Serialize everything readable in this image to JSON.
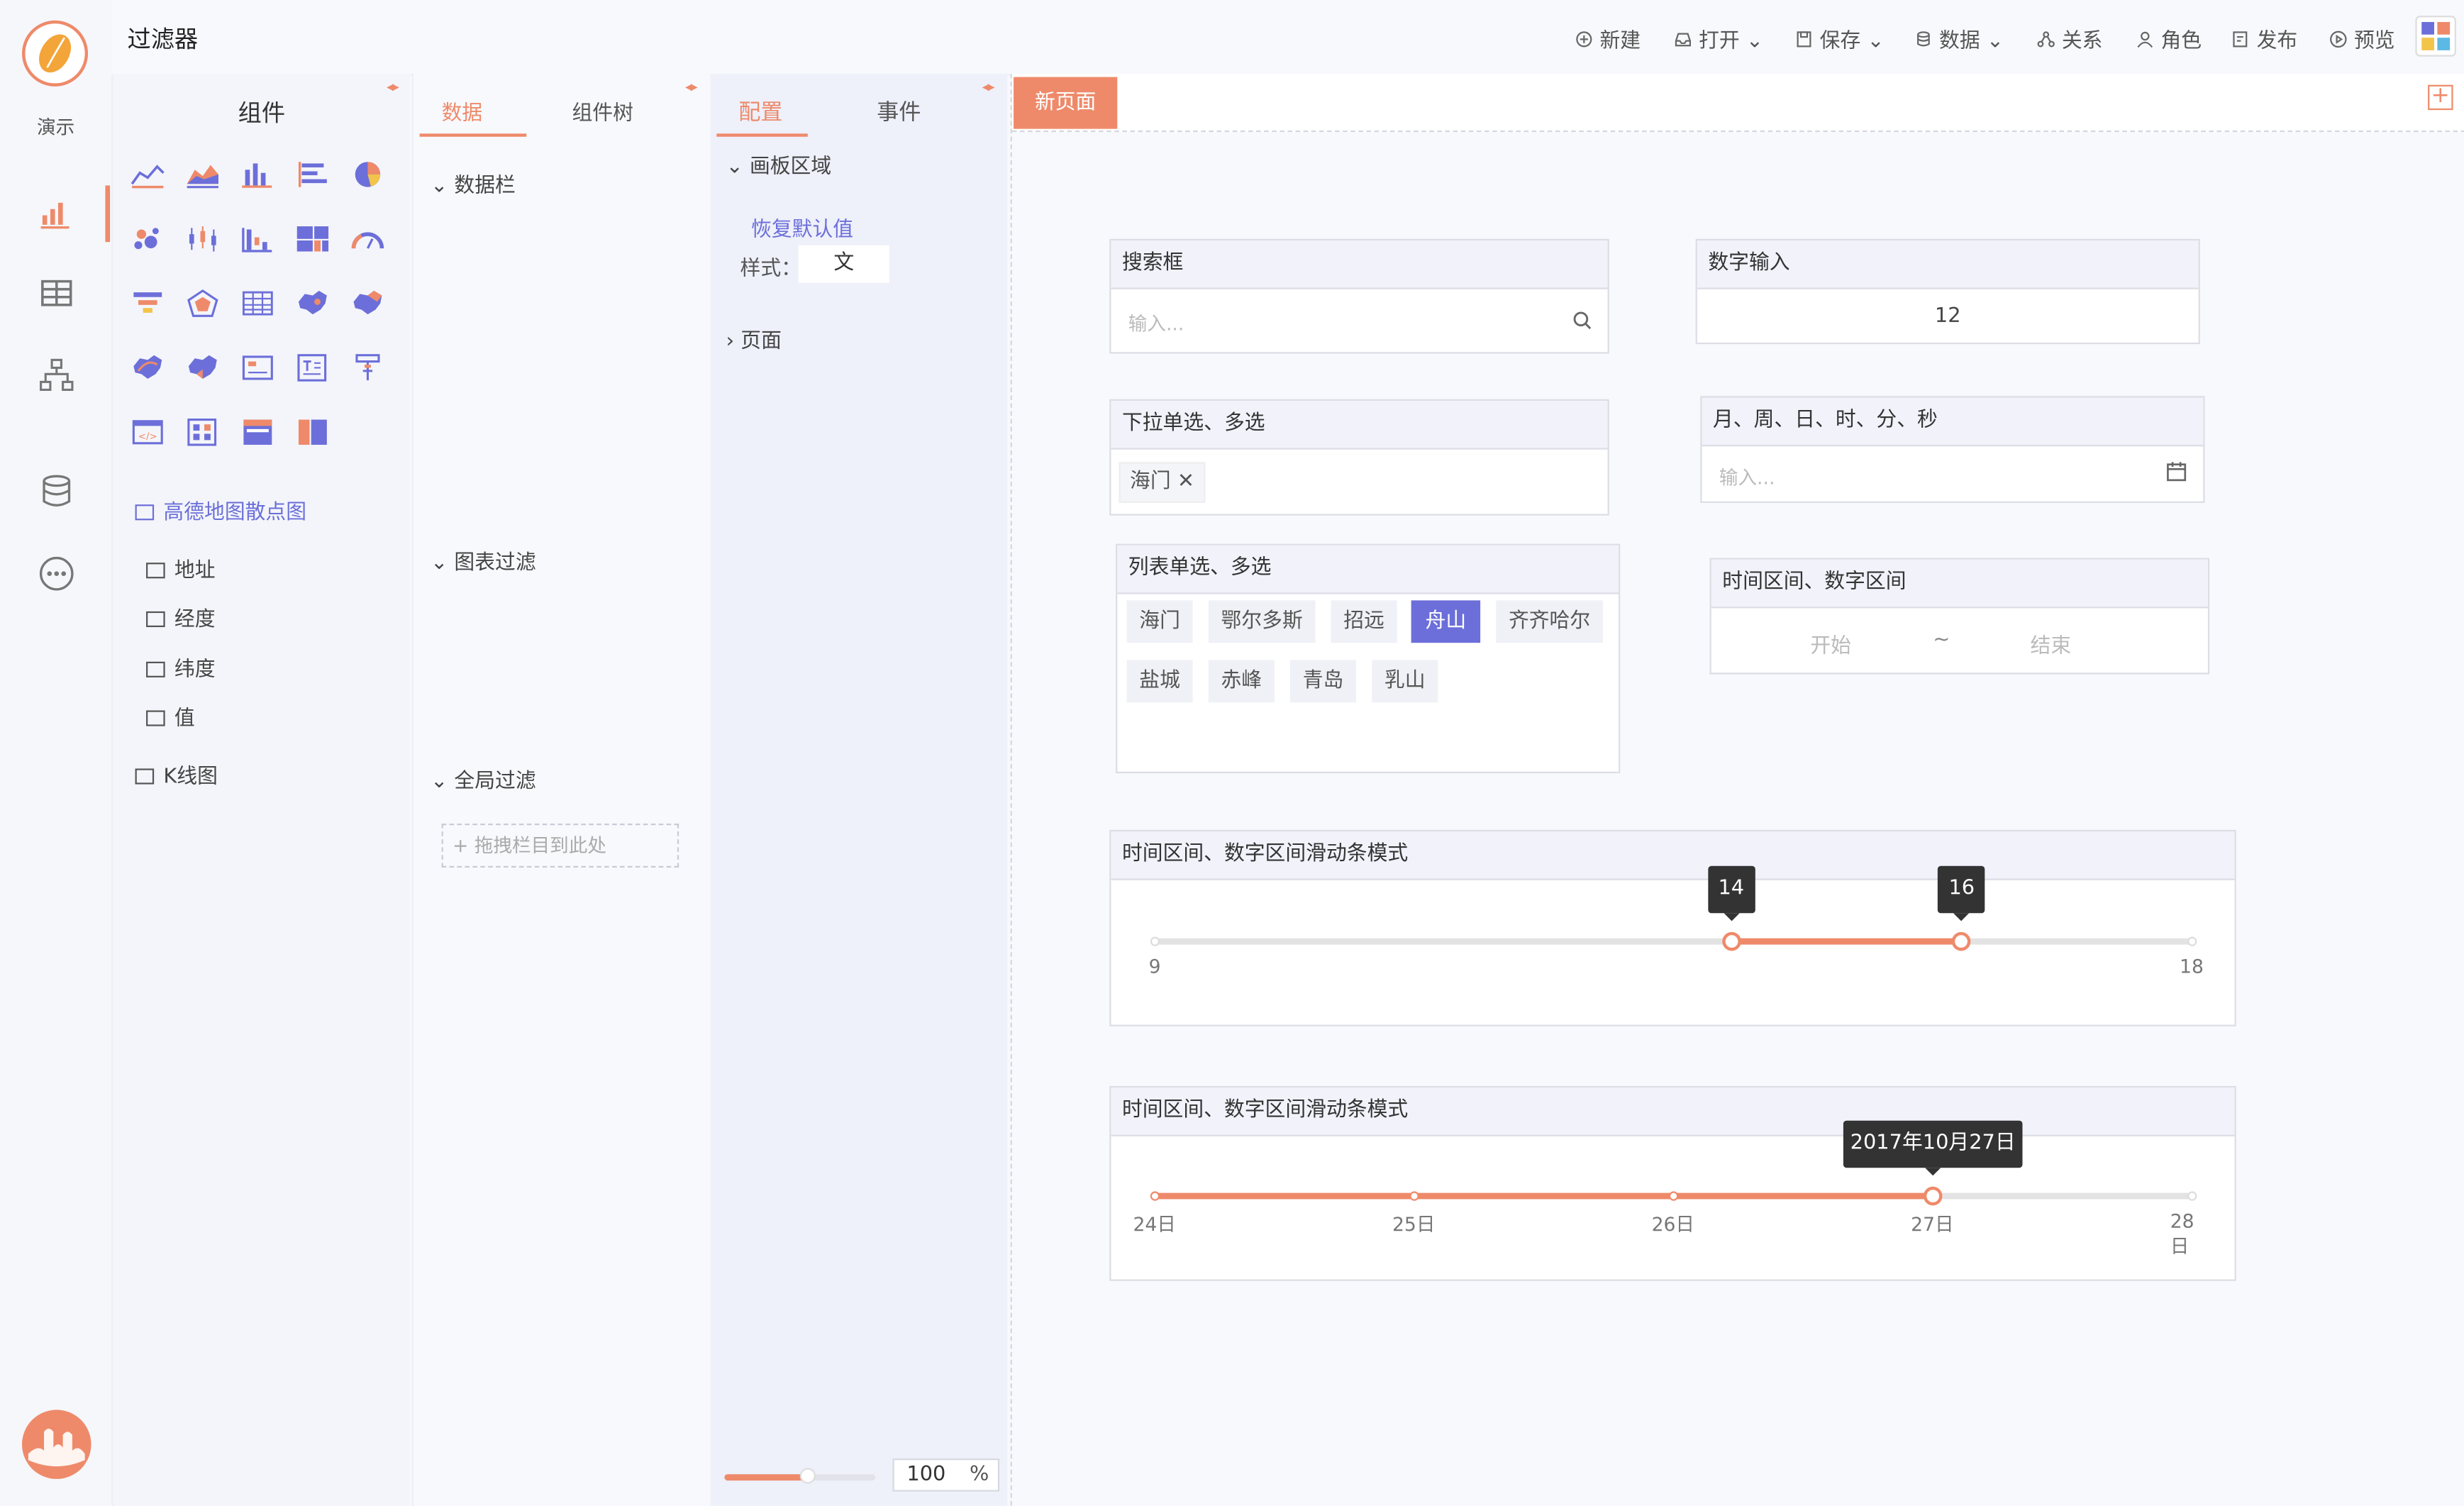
{
  "rail": {
    "label": "演示"
  },
  "topbar": {
    "title": "过滤器",
    "items": [
      {
        "label": "新建",
        "caret": false
      },
      {
        "label": "打开",
        "caret": true
      },
      {
        "label": "保存",
        "caret": true
      },
      {
        "label": "数据",
        "caret": true
      },
      {
        "label": "关系",
        "caret": false
      },
      {
        "label": "角色",
        "caret": false
      },
      {
        "label": "发布",
        "caret": false
      },
      {
        "label": "预览",
        "caret": false
      }
    ]
  },
  "components": {
    "title": "组件",
    "tree": {
      "dataset": "高德地图散点图",
      "fields": [
        "地址",
        "经度",
        "纬度",
        "值"
      ],
      "dataset2": "K线图"
    }
  },
  "data_panel": {
    "tabs": [
      "数据",
      "组件树"
    ],
    "sections": [
      "数据栏",
      "图表过滤",
      "全局过滤"
    ],
    "drop_hint": "+ 拖拽栏目到此处"
  },
  "config_panel": {
    "tabs": [
      "配置",
      "事件"
    ],
    "section_canvas": "画板区域",
    "restore": "恢复默认值",
    "style_label": "样式：",
    "style_value": "文",
    "section_page": "页面",
    "zoom_value": "100",
    "zoom_unit": "%",
    "zoom_fraction": 0.55
  },
  "canvas": {
    "page_tab": "新页面",
    "add_icon": "+",
    "search": {
      "title": "搜索框",
      "placeholder": "输入..."
    },
    "number": {
      "title": "数字输入",
      "value": "12"
    },
    "dropdown": {
      "title": "下拉单选、多选",
      "tag": "海门"
    },
    "date": {
      "title": "月、周、日、时、分、秒",
      "placeholder": "输入..."
    },
    "list": {
      "title": "列表单选、多选",
      "options": [
        "海门",
        "鄂尔多斯",
        "招远",
        "舟山",
        "齐齐哈尔",
        "盐城",
        "赤峰",
        "青岛",
        "乳山"
      ],
      "selected": "舟山"
    },
    "range": {
      "title": "时间区间、数字区间",
      "start": "开始",
      "sep": "~",
      "end": "结束"
    },
    "slider_num": {
      "title": "时间区间、数字区间滑动条模式",
      "min": 9,
      "max": 18,
      "low": 14,
      "high": 16,
      "min_label": "9",
      "max_label": "18",
      "low_label": "14",
      "high_label": "16"
    },
    "slider_date": {
      "title": "时间区间、数字区间滑动条模式",
      "ticks": [
        "24日",
        "25日",
        "26日",
        "27日",
        "28日"
      ],
      "value_index": 3,
      "tooltip": "2017年10月27日"
    }
  }
}
